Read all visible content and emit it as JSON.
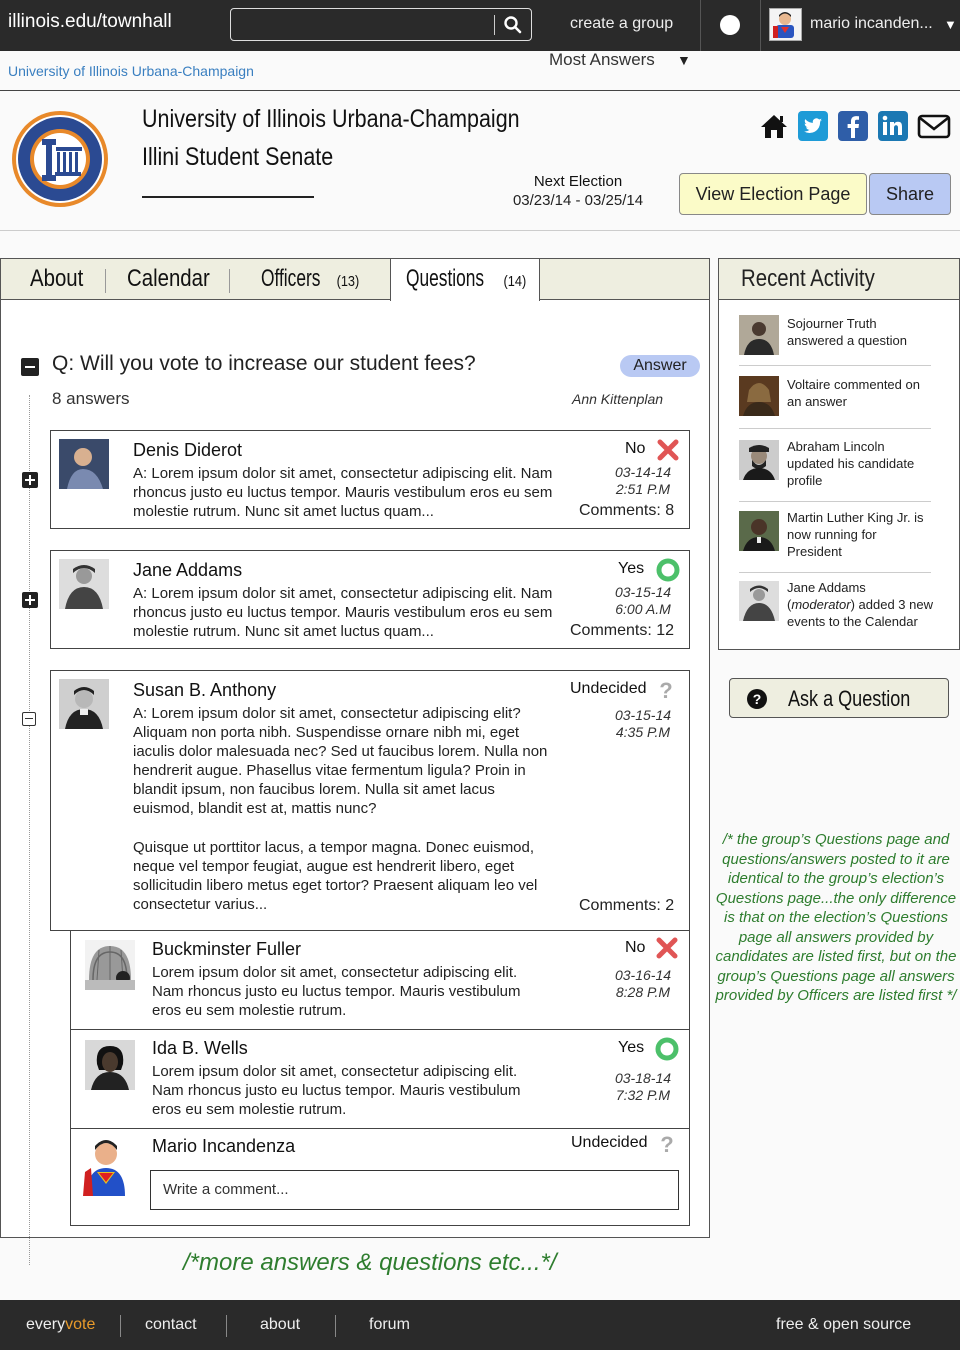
{
  "topnav": {
    "site": "illinois.edu/townhall",
    "search_placeholder": "",
    "create_group": "create a group",
    "user_name": "mario incanden..."
  },
  "breadcrumb": "University of Illinois Urbana-Champaign",
  "header": {
    "university": "University of Illinois Urbana-Champaign",
    "group": "Illini Student Senate",
    "next_election_label": "Next Election",
    "next_election_dates": "03/23/14 - 03/25/14",
    "view_election_button": "View Election Page",
    "share_button": "Share",
    "social_icons": [
      "home-icon",
      "twitter-icon",
      "facebook-icon",
      "linkedin-icon",
      "mail-icon"
    ]
  },
  "tabs": [
    {
      "label": "About",
      "count": ""
    },
    {
      "label": "Calendar",
      "count": ""
    },
    {
      "label": "Officers",
      "count": "(13)"
    },
    {
      "label": "Questions",
      "count": "(14)"
    }
  ],
  "sort_label": "Most Answers",
  "question": {
    "text": "Q: Will you vote to increase our student fees?",
    "answer_button": "Answer",
    "answer_count": "8 answers",
    "asked_by": "Ann Kittenplan"
  },
  "answers": [
    {
      "name": "Denis Diderot",
      "text_prefix": "A:",
      "text": " Lorem ipsum dolor sit amet, consectetur adipiscing elit. Nam rhoncus justo eu luctus tempor. Mauris vestibulum eros eu sem molestie rutrum. Nunc sit amet luctus quam...",
      "vote": "No",
      "date": "03-14-14",
      "time": "2:51 P.M",
      "comments_label": "Comments:",
      "comments": "8"
    },
    {
      "name": "Jane Addams",
      "text_prefix": "A:",
      "text": " Lorem ipsum dolor sit amet, consectetur adipiscing elit. Nam rhoncus justo eu luctus tempor. Mauris vestibulum eros eu sem molestie rutrum. Nunc sit amet luctus quam...",
      "vote": "Yes",
      "date": "03-15-14",
      "time": "6:00 A.M",
      "comments_label": "Comments:",
      "comments": "12"
    },
    {
      "name": "Susan B. Anthony",
      "text_prefix": "A:",
      "text": " Lorem ipsum dolor sit amet, consectetur adipiscing elit? Aliquam non porta nibh. Suspendisse ornare nibh mi, eget iaculis dolor malesuada nec? Sed ut faucibus lorem. Nulla non hendrerit augue. Phasellus vitae fermentum ligula? Proin in blandit ipsum, non faucibus lorem. Nulla sit amet lacus euismod, blandit est at, mattis nunc?",
      "text2": "Quisque ut porttitor lacus, a tempor magna. Donec euismod, neque vel tempor feugiat, augue est hendrerit libero, eget sollicitudin libero metus eget tortor? Praesent aliquam leo vel consectetur varius...",
      "vote": "Undecided",
      "date": "03-15-14",
      "time": "4:35 P.M",
      "comments_label": "Comments:",
      "comments": "2"
    }
  ],
  "comments": [
    {
      "name": "Buckminster Fuller",
      "text": "Lorem ipsum dolor sit amet, consectetur adipiscing elit. Nam rhoncus justo eu luctus tempor. Mauris vestibulum eros eu sem molestie rutrum.",
      "vote": "No",
      "date": "03-16-14",
      "time": "8:28 P.M"
    },
    {
      "name": "Ida B. Wells",
      "text": "Lorem ipsum dolor sit amet, consectetur adipiscing elit. Nam rhoncus justo eu luctus tempor. Mauris vestibulum eros eu sem molestie rutrum.",
      "vote": "Yes",
      "date": "03-18-14",
      "time": "7:32 P.M"
    },
    {
      "name": "Mario Incandenza",
      "vote": "Undecided",
      "input_placeholder": "Write a comment..."
    }
  ],
  "recent_activity": {
    "title": "Recent Activity",
    "items": [
      "Sojourner Truth answered a question",
      "Voltaire commented on an answer",
      "Abraham Lincoln updated his candidate profile",
      "Martin Luther King Jr. is now running for President"
    ],
    "jane_item": {
      "pre": "Jane Addams (",
      "em": "moderator",
      "post": ") added 3 new events to the Calendar"
    }
  },
  "ask_button": "Ask a Question",
  "note": "/* the group’s Questions page and questions/answers posted to it are identical to the group’s election’s Questions page...the only difference is that on the election’s Questions page all answers provided by candidates are listed first, but on the group’s Questions page all answers provided by Officers are listed first */",
  "more_note": "/*more answers & questions etc...*/",
  "footer": {
    "brand_a": "every",
    "brand_b": "vote",
    "links": [
      "contact",
      "about",
      "forum"
    ],
    "right": "free & open source"
  },
  "colors": {
    "accent_blue": "#b9c9f3",
    "election_yellow": "#fbfbc8",
    "note_green": "#2e7d2e",
    "link_blue": "#3a7fc0",
    "no_red": "#e05555",
    "yes_green": "#4cc06a"
  }
}
